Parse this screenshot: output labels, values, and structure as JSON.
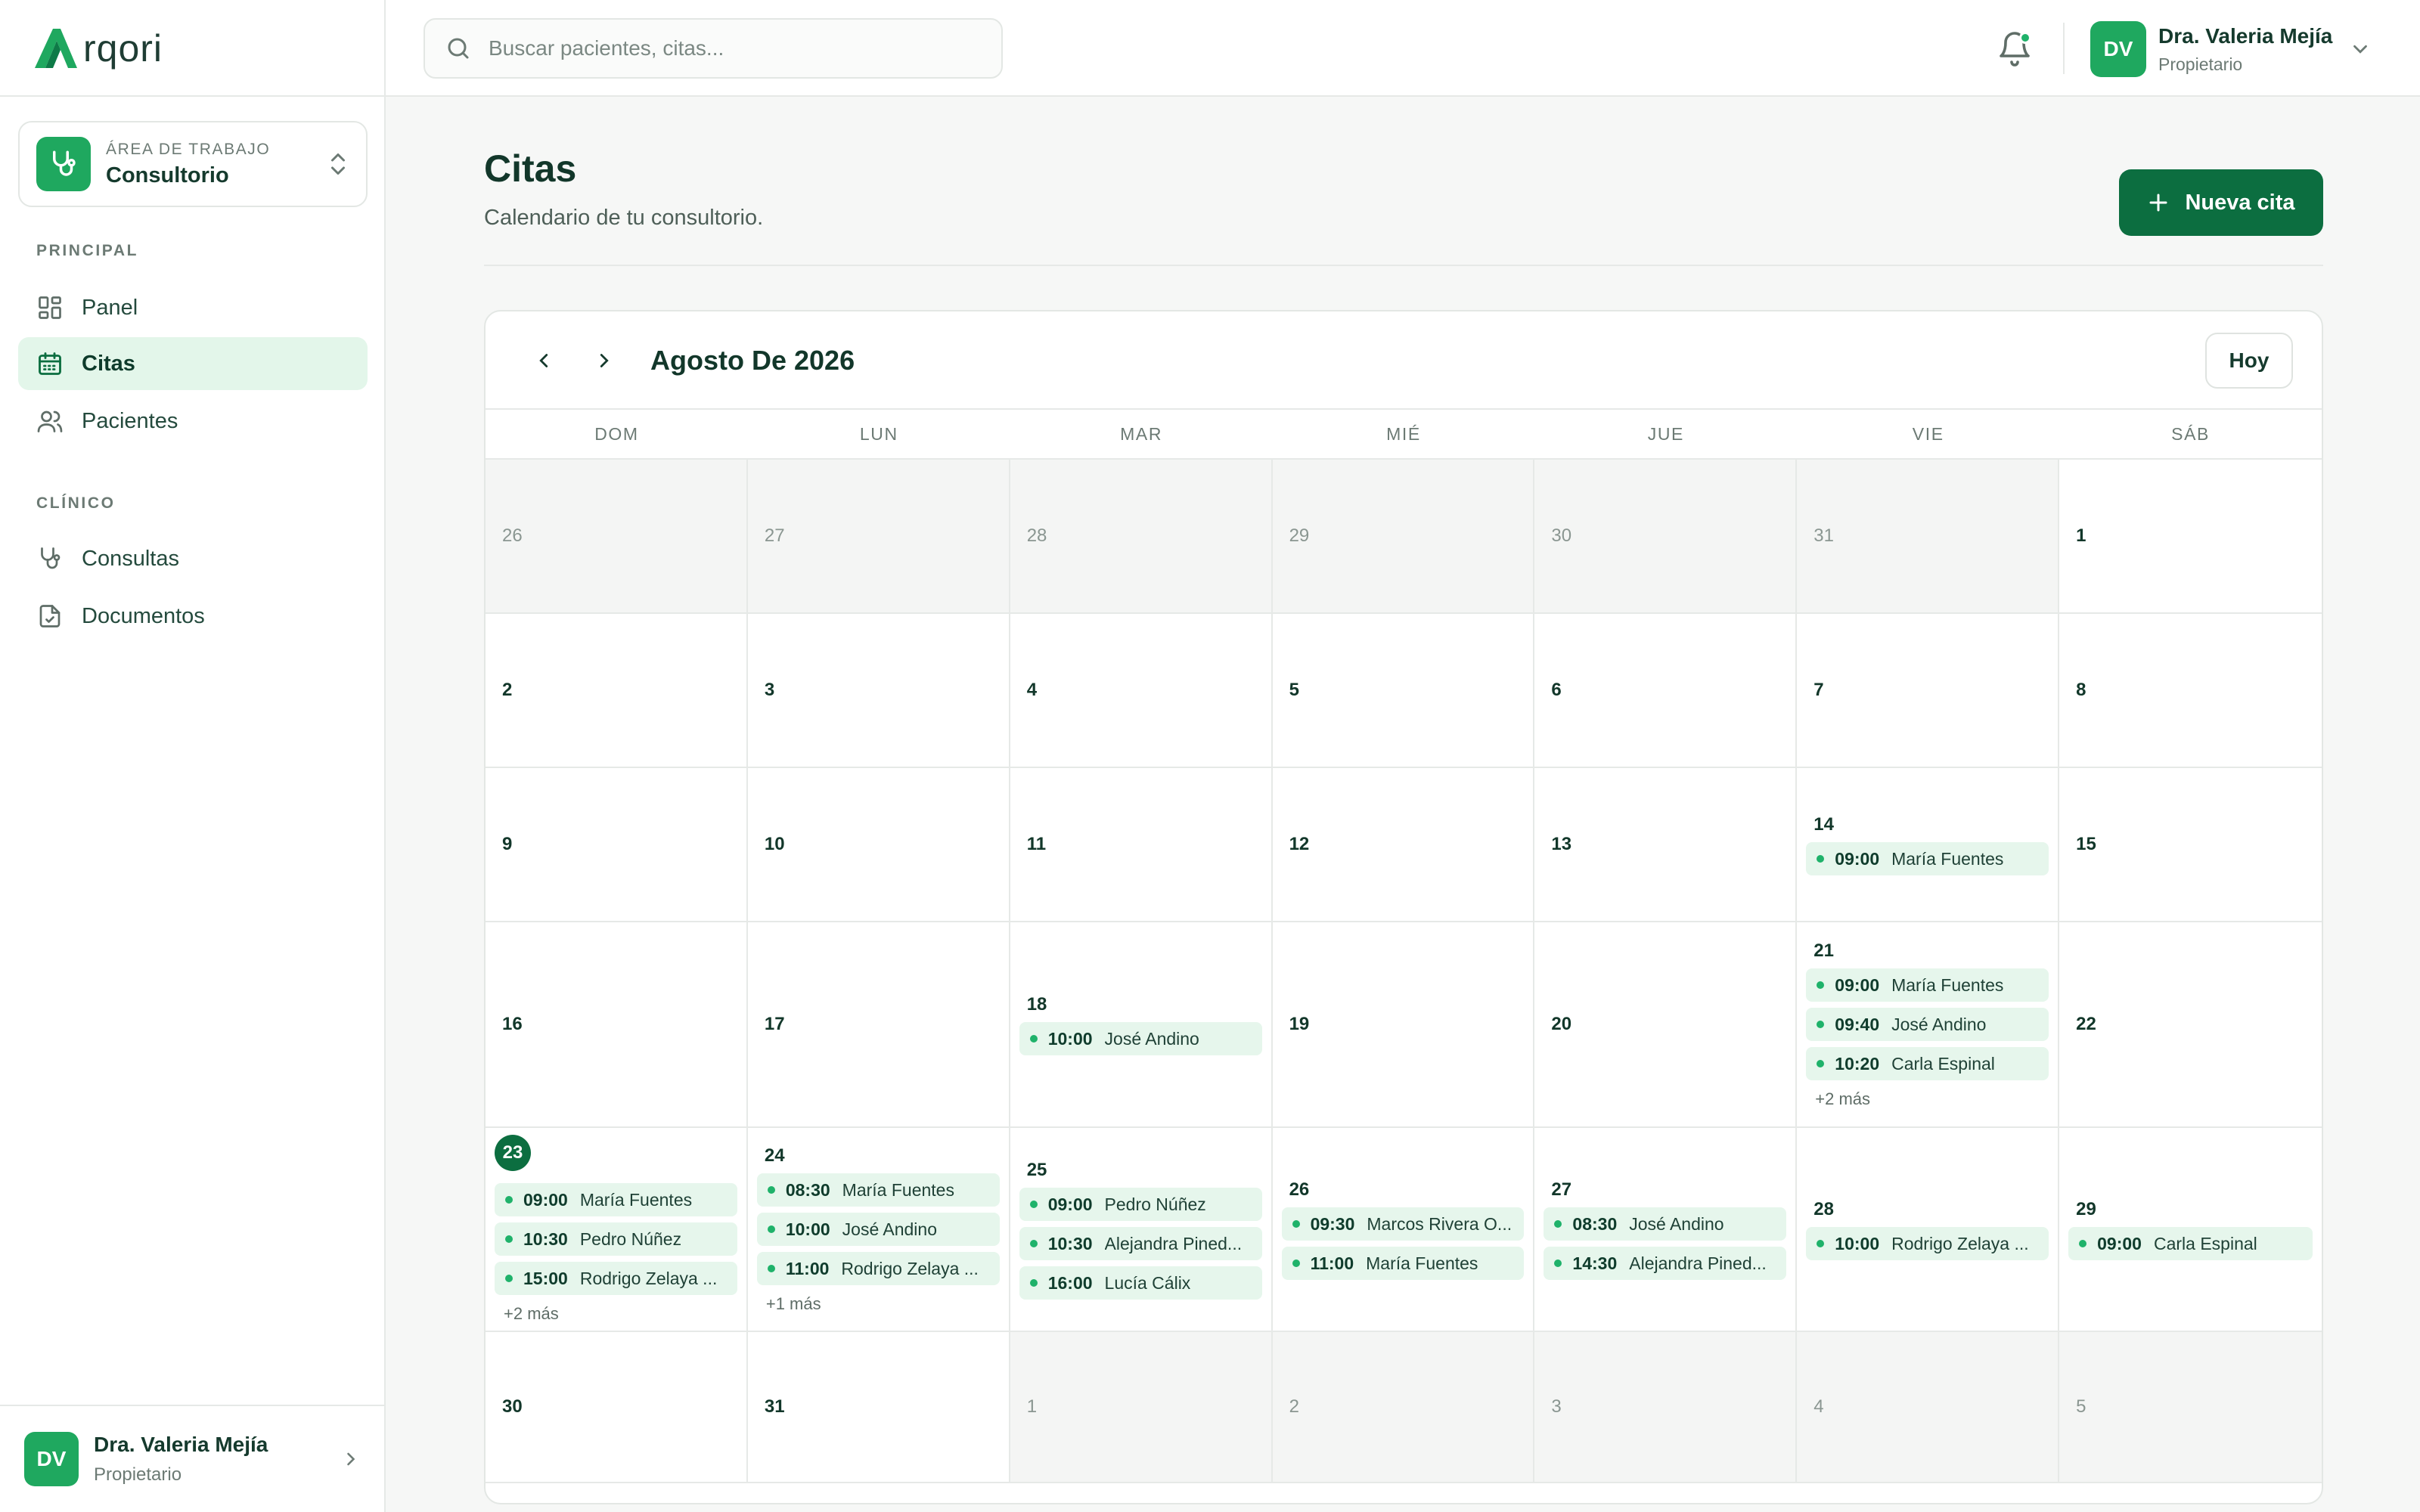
{
  "brand": {
    "logo_text": "rqori",
    "logo_mark": "A"
  },
  "colors": {
    "accent": "#0c6e40",
    "accent_light": "#1fa85f",
    "event_bg": "#e6f6ec",
    "dot": "#1fb26a"
  },
  "workspace": {
    "label": "ÁREA DE TRABAJO",
    "name": "Consultorio",
    "icon": "stethoscope-icon"
  },
  "nav": {
    "section_principal": "PRINCIPAL",
    "section_clinico": "CLÍNICO",
    "items": [
      {
        "label": "Panel",
        "icon": "dashboard-icon"
      },
      {
        "label": "Citas",
        "icon": "calendar-icon",
        "active": true
      },
      {
        "label": "Pacientes",
        "icon": "users-icon"
      },
      {
        "label": "Consultas",
        "icon": "stethoscope-icon"
      },
      {
        "label": "Documentos",
        "icon": "document-icon"
      }
    ]
  },
  "user": {
    "initials": "DV",
    "name": "Dra. Valeria Mejía",
    "role": "Propietario"
  },
  "search": {
    "placeholder": "Buscar pacientes, citas..."
  },
  "page": {
    "title": "Citas",
    "subtitle": "Calendario de tu consultorio.",
    "new_button": "Nueva cita"
  },
  "calendar": {
    "month_label": "Agosto De 2026",
    "today_button": "Hoy",
    "weekdays": [
      "DOM",
      "LUN",
      "MAR",
      "MIÉ",
      "JUE",
      "VIE",
      "SÁB"
    ],
    "weeks": [
      {
        "days": [
          {
            "day": "26",
            "muted": true,
            "events": []
          },
          {
            "day": "27",
            "muted": true,
            "events": []
          },
          {
            "day": "28",
            "muted": true,
            "events": []
          },
          {
            "day": "29",
            "muted": true,
            "events": []
          },
          {
            "day": "30",
            "muted": true,
            "events": []
          },
          {
            "day": "31",
            "muted": true,
            "events": []
          },
          {
            "day": "1",
            "events": []
          }
        ]
      },
      {
        "days": [
          {
            "day": "2",
            "events": []
          },
          {
            "day": "3",
            "events": []
          },
          {
            "day": "4",
            "events": []
          },
          {
            "day": "5",
            "events": []
          },
          {
            "day": "6",
            "events": []
          },
          {
            "day": "7",
            "events": []
          },
          {
            "day": "8",
            "events": []
          }
        ]
      },
      {
        "days": [
          {
            "day": "9",
            "events": []
          },
          {
            "day": "10",
            "events": []
          },
          {
            "day": "11",
            "events": []
          },
          {
            "day": "12",
            "events": []
          },
          {
            "day": "13",
            "events": []
          },
          {
            "day": "14",
            "events": [
              {
                "time": "09:00",
                "name": "María Fuentes"
              }
            ]
          },
          {
            "day": "15",
            "events": []
          }
        ]
      },
      {
        "days": [
          {
            "day": "16",
            "events": []
          },
          {
            "day": "17",
            "events": []
          },
          {
            "day": "18",
            "events": [
              {
                "time": "10:00",
                "name": "José Andino"
              }
            ]
          },
          {
            "day": "19",
            "events": []
          },
          {
            "day": "20",
            "events": []
          },
          {
            "day": "21",
            "events": [
              {
                "time": "09:00",
                "name": "María Fuentes"
              },
              {
                "time": "09:40",
                "name": "José Andino"
              },
              {
                "time": "10:20",
                "name": "Carla Espinal"
              }
            ],
            "more": "+2 más"
          },
          {
            "day": "22",
            "events": []
          }
        ]
      },
      {
        "days": [
          {
            "day": "23",
            "today": true,
            "events": [
              {
                "time": "09:00",
                "name": "María Fuentes"
              },
              {
                "time": "10:30",
                "name": "Pedro Núñez"
              },
              {
                "time": "15:00",
                "name": "Rodrigo Zelaya ..."
              }
            ],
            "more": "+2 más"
          },
          {
            "day": "24",
            "events": [
              {
                "time": "08:30",
                "name": "María Fuentes"
              },
              {
                "time": "10:00",
                "name": "José Andino"
              },
              {
                "time": "11:00",
                "name": "Rodrigo Zelaya ..."
              }
            ],
            "more": "+1 más"
          },
          {
            "day": "25",
            "events": [
              {
                "time": "09:00",
                "name": "Pedro Núñez"
              },
              {
                "time": "10:30",
                "name": "Alejandra Pined..."
              },
              {
                "time": "16:00",
                "name": "Lucía Cálix"
              }
            ]
          },
          {
            "day": "26",
            "events": [
              {
                "time": "09:30",
                "name": "Marcos Rivera O..."
              },
              {
                "time": "11:00",
                "name": "María Fuentes"
              }
            ]
          },
          {
            "day": "27",
            "events": [
              {
                "time": "08:30",
                "name": "José Andino"
              },
              {
                "time": "14:30",
                "name": "Alejandra Pined..."
              }
            ]
          },
          {
            "day": "28",
            "events": [
              {
                "time": "10:00",
                "name": "Rodrigo Zelaya ..."
              }
            ]
          },
          {
            "day": "29",
            "events": [
              {
                "time": "09:00",
                "name": "Carla Espinal"
              }
            ]
          }
        ]
      },
      {
        "days": [
          {
            "day": "30",
            "events": []
          },
          {
            "day": "31",
            "events": []
          },
          {
            "day": "1",
            "muted": true,
            "events": []
          },
          {
            "day": "2",
            "muted": true,
            "events": []
          },
          {
            "day": "3",
            "muted": true,
            "events": []
          },
          {
            "day": "4",
            "muted": true,
            "events": []
          },
          {
            "day": "5",
            "muted": true,
            "events": []
          }
        ]
      }
    ]
  }
}
